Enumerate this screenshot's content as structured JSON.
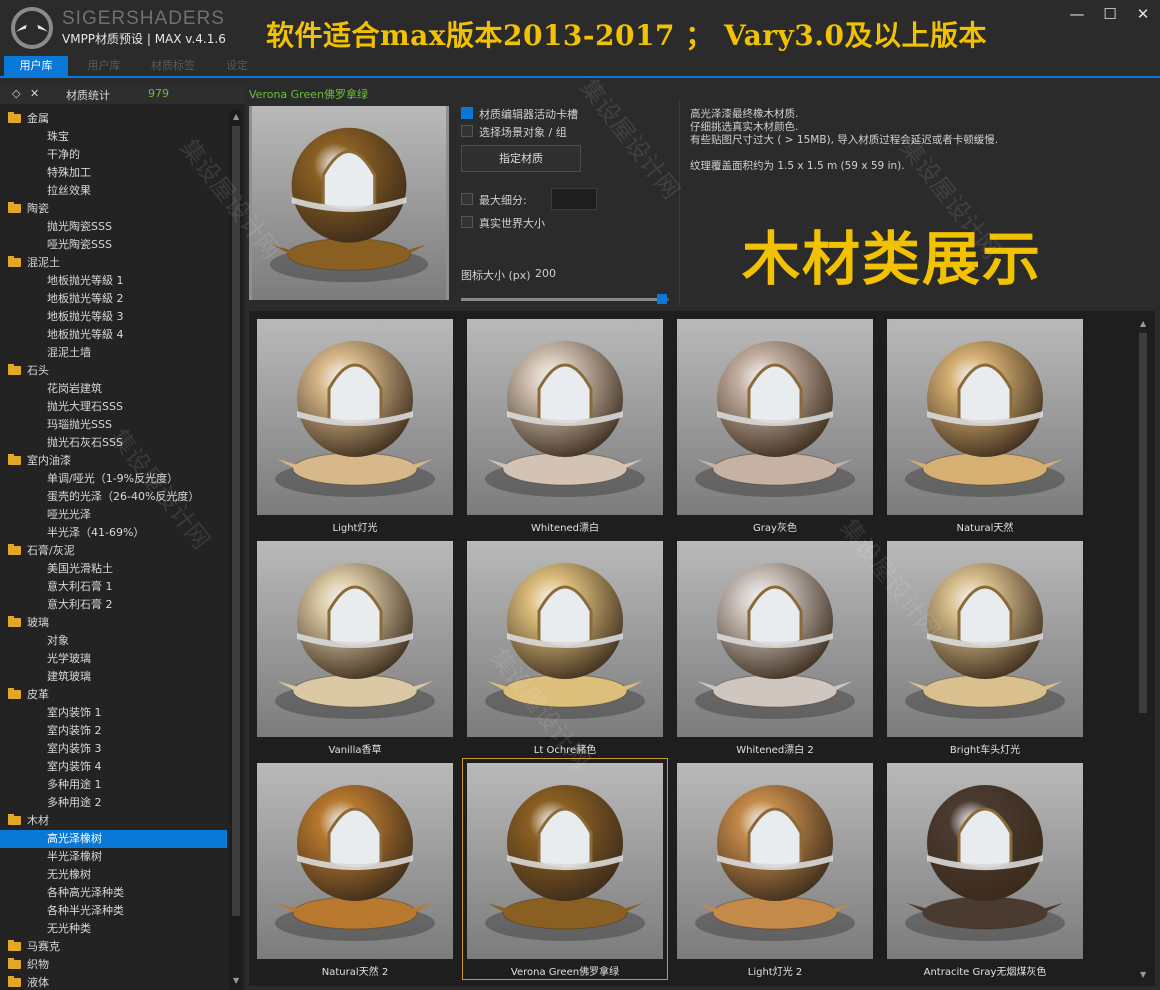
{
  "window": {
    "brand": "SIGERSHADERS",
    "version": "VMPP材质预设 | MAX v.4.1.6",
    "banner": "软件适合max版本2013-2017 ； Vary3.0及以上版本",
    "controls": [
      "—",
      "☐",
      "✕"
    ]
  },
  "tabs": [
    {
      "label": "用户库",
      "active": true
    },
    {
      "label": "用户库",
      "active": false
    },
    {
      "label": "材质标签",
      "active": false
    },
    {
      "label": "设定",
      "active": false
    }
  ],
  "tree": {
    "header": {
      "expand_icon": "◇",
      "close_icon": "✕",
      "label": "材质统计",
      "count": "979"
    },
    "nodes": [
      {
        "type": "cat",
        "label": "金属"
      },
      {
        "type": "item",
        "label": "珠宝"
      },
      {
        "type": "item",
        "label": "干净的"
      },
      {
        "type": "item",
        "label": "特殊加工"
      },
      {
        "type": "item",
        "label": "拉丝效果"
      },
      {
        "type": "cat",
        "label": "陶瓷"
      },
      {
        "type": "item",
        "label": "抛光陶瓷SSS"
      },
      {
        "type": "item",
        "label": "哑光陶瓷SSS"
      },
      {
        "type": "cat",
        "label": "混泥土"
      },
      {
        "type": "item",
        "label": "地板抛光等級 1"
      },
      {
        "type": "item",
        "label": "地板抛光等級 2"
      },
      {
        "type": "item",
        "label": "地板抛光等級 3"
      },
      {
        "type": "item",
        "label": "地板抛光等級 4"
      },
      {
        "type": "item",
        "label": "混泥土墙"
      },
      {
        "type": "cat",
        "label": "石头"
      },
      {
        "type": "item",
        "label": "花岗岩建筑"
      },
      {
        "type": "item",
        "label": "抛光大理石SSS"
      },
      {
        "type": "item",
        "label": "玛瑙抛光SSS"
      },
      {
        "type": "item",
        "label": "抛光石灰石SSS"
      },
      {
        "type": "cat",
        "label": "室内油漆"
      },
      {
        "type": "item",
        "label": "单调/哑光（1-9%反光度）"
      },
      {
        "type": "item",
        "label": "蛋壳的光泽（26-40%反光度）"
      },
      {
        "type": "item",
        "label": "哑光光泽"
      },
      {
        "type": "item",
        "label": "半光泽（41-69%）"
      },
      {
        "type": "cat",
        "label": "石膏/灰泥"
      },
      {
        "type": "item",
        "label": "美国光滑粘土"
      },
      {
        "type": "item",
        "label": "意大利石膏 1"
      },
      {
        "type": "item",
        "label": "意大利石膏 2"
      },
      {
        "type": "cat",
        "label": "玻璃"
      },
      {
        "type": "item",
        "label": "对象"
      },
      {
        "type": "item",
        "label": "光学玻璃"
      },
      {
        "type": "item",
        "label": "建筑玻璃"
      },
      {
        "type": "cat",
        "label": "皮革"
      },
      {
        "type": "item",
        "label": "室内装饰 1"
      },
      {
        "type": "item",
        "label": "室内装饰 2"
      },
      {
        "type": "item",
        "label": "室内装饰 3"
      },
      {
        "type": "item",
        "label": "室内装饰 4"
      },
      {
        "type": "item",
        "label": "多种用途 1"
      },
      {
        "type": "item",
        "label": "多种用途 2"
      },
      {
        "type": "cat",
        "label": "木材"
      },
      {
        "type": "item",
        "label": "高光泽橡树",
        "selected": true
      },
      {
        "type": "item",
        "label": "半光泽橡树"
      },
      {
        "type": "item",
        "label": "无光橡树"
      },
      {
        "type": "item",
        "label": "各种高光泽种类"
      },
      {
        "type": "item",
        "label": "各种半光泽种类"
      },
      {
        "type": "item",
        "label": "无光种类"
      },
      {
        "type": "cat",
        "label": "马赛克"
      },
      {
        "type": "cat",
        "label": "织物"
      },
      {
        "type": "cat",
        "label": "液体"
      }
    ]
  },
  "detail": {
    "material_name": "Verona Green佛罗拿绿",
    "opt_active_slot": "材质编辑器活动卡槽",
    "opt_select_scene": "选择场景对象 / 组",
    "assign_button": "指定材质",
    "opt_max_subdiv": "最大细分:",
    "opt_real_world": "真实世界大小",
    "icon_size_label": "图标大小 (px)",
    "icon_size_value": "200",
    "icon_size_fraction": 0.97,
    "description": [
      "高光泽漆最终橡木材质.",
      "仔细挑选真实木材颜色.",
      "有些贴图尺寸过大 ( > 15MB), 导入材质过程会延迟或者卡顿缓慢.",
      "",
      "纹理覆盖面积约为 1.5 x 1.5 m (59 x 59 in)."
    ],
    "wood_title": "木材类展示"
  },
  "swatches": [
    {
      "label": "Light灯光",
      "color": "#d7b88a"
    },
    {
      "label": "Whitened漂白",
      "color": "#d3c3b4"
    },
    {
      "label": "Gray灰色",
      "color": "#c6b2a4"
    },
    {
      "label": "Natural天然",
      "color": "#d6b072"
    },
    {
      "label": "Vanilla香草",
      "color": "#dac9a4"
    },
    {
      "label": "Lt Ochre赭色",
      "color": "#ddbf7c"
    },
    {
      "label": "Whitened漂白 2",
      "color": "#cfc6c0"
    },
    {
      "label": "Bright车头灯光",
      "color": "#d9c08e"
    },
    {
      "label": "Natural天然 2",
      "color": "#b8782e"
    },
    {
      "label": "Verona Green佛罗拿绿",
      "color": "#8a5f22",
      "selected": true
    },
    {
      "label": "Light灯光 2",
      "color": "#c48a4a"
    },
    {
      "label": "Antracite Gray无烟煤灰色",
      "color": "#4a3a30"
    }
  ],
  "watermark": "集设屋设计网",
  "accent": "#0a78d7",
  "title_color": "#f2c200"
}
